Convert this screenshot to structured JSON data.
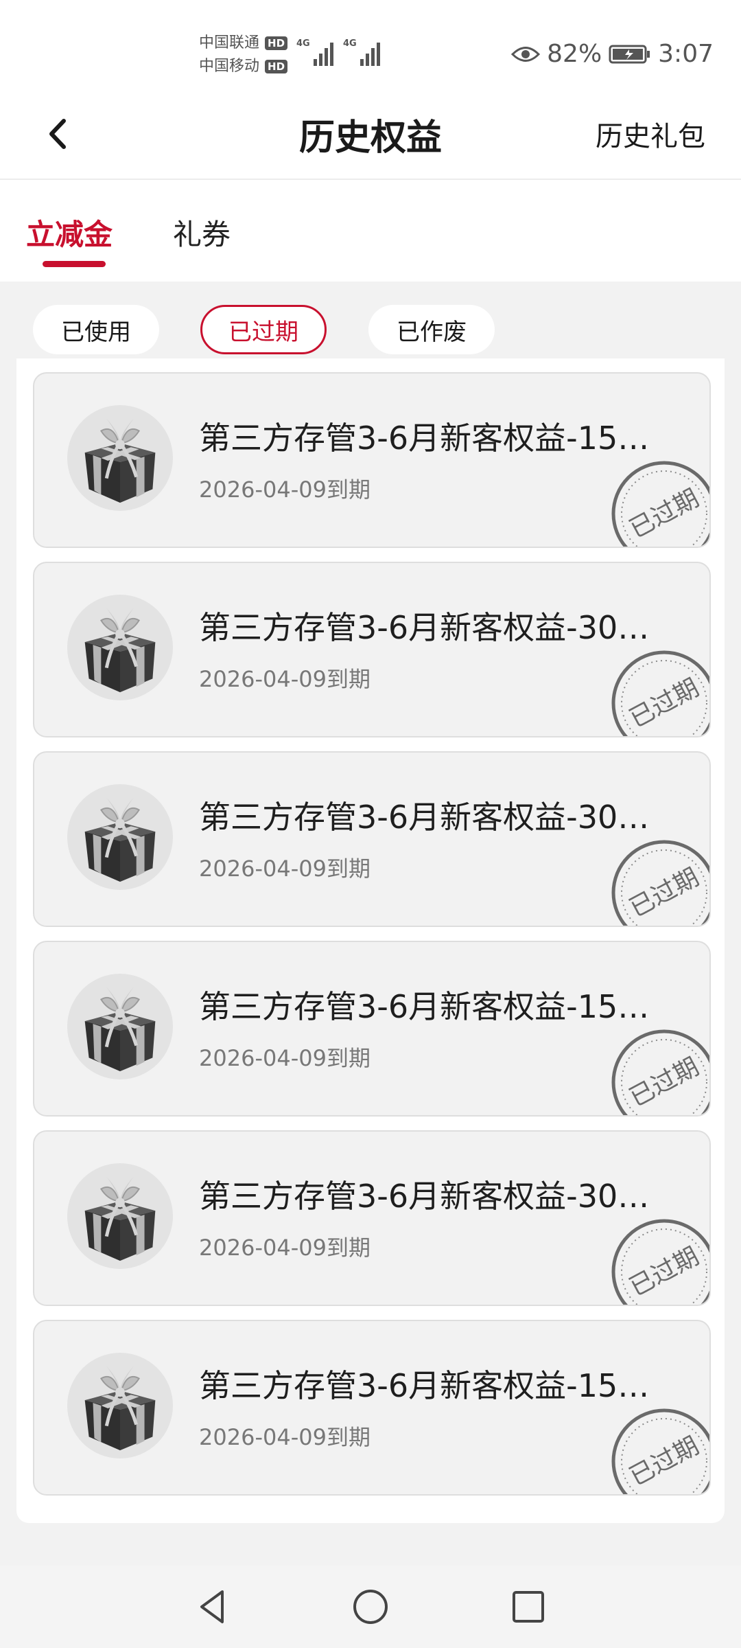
{
  "status_bar": {
    "carrier_1": "中国联通",
    "carrier_2": "中国移动",
    "hd_badge": "HD",
    "network_1": "4G",
    "network_2": "4G",
    "battery_percent": "82%",
    "time": "3:07",
    "icons": [
      "eye-icon",
      "signal-icon",
      "battery-charging-icon"
    ]
  },
  "header": {
    "title": "历史权益",
    "right_link": "历史礼包",
    "back_icon": "chevron-left-icon"
  },
  "tabs": [
    {
      "label": "立减金",
      "active": true
    },
    {
      "label": "礼券",
      "active": false
    }
  ],
  "filters": [
    {
      "label": "已使用",
      "selected": false
    },
    {
      "label": "已过期",
      "selected": true
    },
    {
      "label": "已作废",
      "selected": false
    }
  ],
  "coupons": [
    {
      "title": "第三方存管3-6月新客权益-15…",
      "expiry": "2026-04-09到期",
      "stamp": "已过期"
    },
    {
      "title": "第三方存管3-6月新客权益-30…",
      "expiry": "2026-04-09到期",
      "stamp": "已过期"
    },
    {
      "title": "第三方存管3-6月新客权益-30…",
      "expiry": "2026-04-09到期",
      "stamp": "已过期"
    },
    {
      "title": "第三方存管3-6月新客权益-15…",
      "expiry": "2026-04-09到期",
      "stamp": "已过期"
    },
    {
      "title": "第三方存管3-6月新客权益-30…",
      "expiry": "2026-04-09到期",
      "stamp": "已过期"
    },
    {
      "title": "第三方存管3-6月新客权益-15…",
      "expiry": "2026-04-09到期",
      "stamp": "已过期"
    }
  ],
  "nav": {
    "icons": [
      "back-triangle-icon",
      "home-circle-icon",
      "recents-square-icon"
    ]
  },
  "colors": {
    "accent": "#c8102e",
    "background": "#f2f2f2",
    "card": "#f2f2f2",
    "text": "#1e1e1e",
    "muted": "#777777"
  }
}
